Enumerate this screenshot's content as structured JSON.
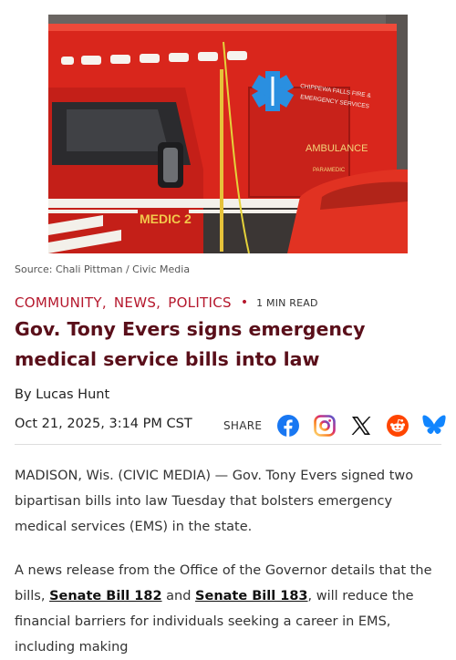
{
  "image": {
    "source_caption": "Source: Chali Pittman / Civic Media",
    "vehicle_label": "MEDIC 2",
    "ambulance_label": "AMBULANCE",
    "side_text_1": "CHIPPEWA FALLS FIRE &",
    "side_text_2": "EMERGENCY SERVICES",
    "side_text_3": "PARAMEDIC"
  },
  "categories": [
    "COMMUNITY,",
    "NEWS,",
    "POLITICS"
  ],
  "read_time": "1 MIN READ",
  "title": "Gov. Tony Evers signs emergency medical service bills into law",
  "byline": "By Lucas Hunt",
  "date": "Oct 21, 2025, 3:14 PM CST",
  "share": {
    "label": "SHARE",
    "networks": [
      "facebook",
      "instagram",
      "x",
      "reddit",
      "bluesky"
    ]
  },
  "body": {
    "p1": "MADISON, Wis. (CIVIC MEDIA) — Gov. Tony Evers signed two bipartisan bills into law Tuesday that bolsters emergency medical services (EMS) in the state.",
    "p2_before": "A news release from the Office of the Governor details that the bills, ",
    "p2_link1": "Senate Bill 182",
    "p2_between": " and ",
    "p2_link2": "Senate Bill 183",
    "p2_after": ", will reduce the financial barriers for individuals seeking a career in EMS, including making"
  },
  "colors": {
    "accent": "#b5172c",
    "title": "#5a0f1a",
    "facebook": "#1877f2",
    "reddit": "#ff4500",
    "bluesky": "#1185fe"
  }
}
